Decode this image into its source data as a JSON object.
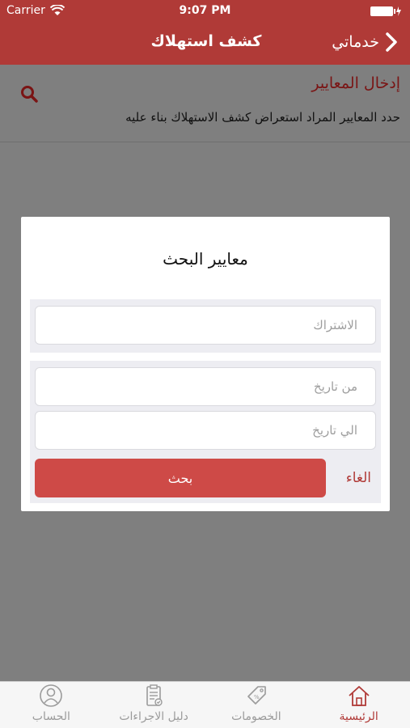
{
  "status": {
    "carrier": "Carrier",
    "time": "9:07 PM"
  },
  "nav": {
    "title": "كشف استهلاك",
    "back_label": "خدماتي"
  },
  "criteria": {
    "title": "إدخال المعايير",
    "description": "حدد المعايير المراد استعراض كشف الاستهلاك بناء عليه"
  },
  "modal": {
    "title": "معايير البحث",
    "subscription_placeholder": "الاشتراك",
    "from_date_placeholder": "من تاريخ",
    "to_date_placeholder": "الي تاريخ",
    "search_label": "بحث",
    "cancel_label": "الغاء"
  },
  "tabs": [
    {
      "label": "الحساب",
      "icon": "account-icon"
    },
    {
      "label": "دليل الاجراءات",
      "icon": "procedures-guide-icon"
    },
    {
      "label": "الخصومات",
      "icon": "discounts-icon"
    },
    {
      "label": "الرئيسية",
      "icon": "home-icon",
      "active": true
    }
  ],
  "colors": {
    "brand": "#b03a37",
    "button": "#ce4a47",
    "overlay": "#7f7f7f"
  }
}
